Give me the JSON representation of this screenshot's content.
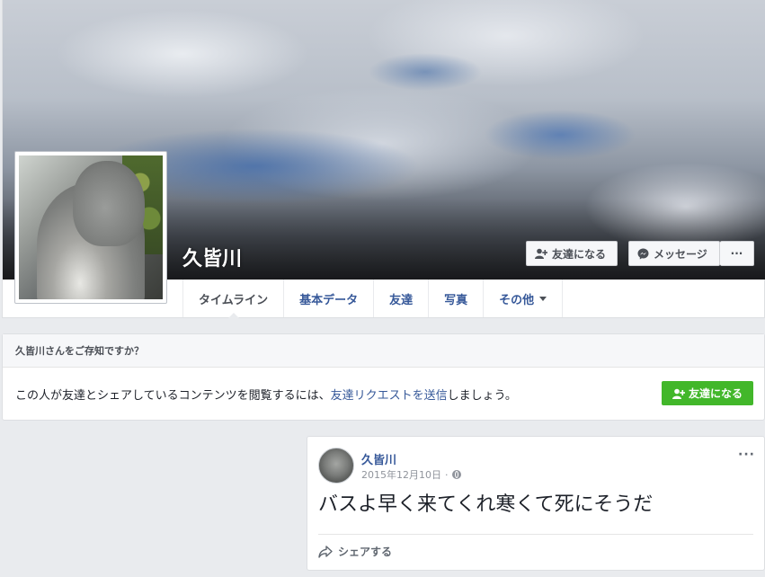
{
  "profile": {
    "name": "久皆川"
  },
  "cover_actions": {
    "add_friend_label": "友達になる",
    "message_label": "メッセージ",
    "more_label": "···"
  },
  "tabs": [
    {
      "label": "タイムライン"
    },
    {
      "label": "基本データ"
    },
    {
      "label": "友達"
    },
    {
      "label": "写真"
    },
    {
      "label": "その他"
    }
  ],
  "know_box": {
    "heading": "久皆川さんをご存知ですか？",
    "body_before": "この人が友達とシェアしているコンテンツを閲覧するには、",
    "link_text": "友達リクエストを送信",
    "body_after": "しましょう。",
    "button_label": "友達になる"
  },
  "post": {
    "author": "久皆川",
    "date": "2015年12月10日",
    "separator": "·",
    "text": "バスよ早く来てくれ寒くて死にそうだ",
    "share_label": "シェアする",
    "menu_label": "···"
  },
  "colors": {
    "link": "#365899",
    "green_button": "#42b72a",
    "page_bg": "#e9ebee"
  }
}
